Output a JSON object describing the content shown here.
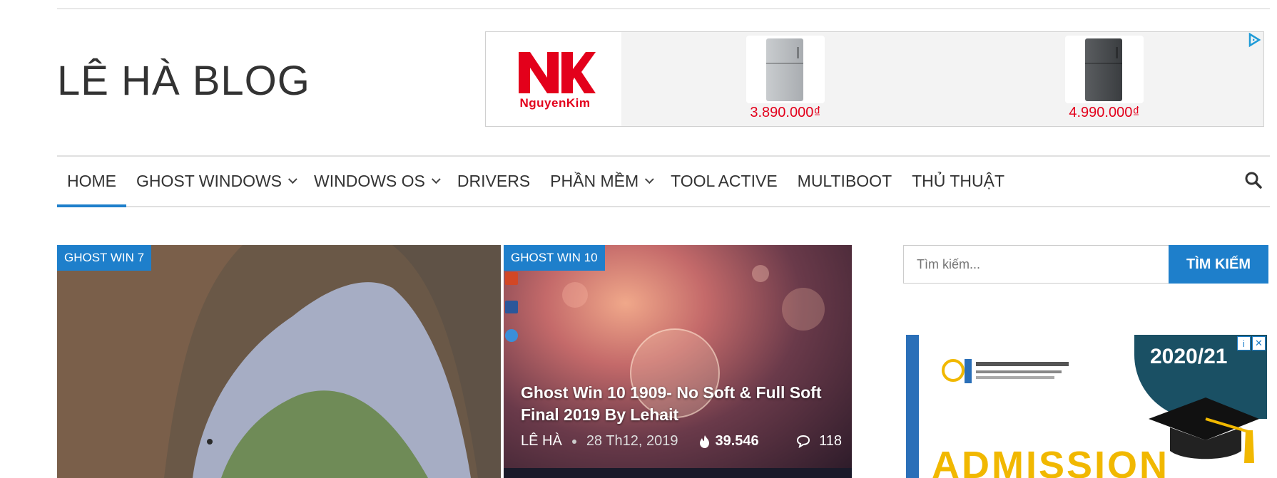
{
  "site": {
    "title": "LÊ HÀ BLOG"
  },
  "ad_banner": {
    "brand": "NK",
    "brand_sub": "NguyenKim",
    "products": [
      {
        "price": "3.890.000₫",
        "color": "#b8bcbf"
      },
      {
        "price": "4.990.000₫",
        "color": "#4a4d50"
      }
    ]
  },
  "nav": {
    "items": [
      {
        "label": "HOME",
        "active": true,
        "dropdown": false
      },
      {
        "label": "GHOST WINDOWS",
        "active": false,
        "dropdown": true
      },
      {
        "label": "WINDOWS OS",
        "active": false,
        "dropdown": true
      },
      {
        "label": "DRIVERS",
        "active": false,
        "dropdown": false
      },
      {
        "label": "PHẦN MỀM",
        "active": false,
        "dropdown": true
      },
      {
        "label": "TOOL ACTIVE",
        "active": false,
        "dropdown": false
      },
      {
        "label": "MULTIBOOT",
        "active": false,
        "dropdown": false
      },
      {
        "label": "THỦ THUẬT",
        "active": false,
        "dropdown": false
      }
    ],
    "search_icon": "search-icon"
  },
  "posts": [
    {
      "category": "GHOST WIN 7"
    },
    {
      "category": "GHOST WIN 10",
      "title": "Ghost Win 10 1909- No Soft & Full Soft Final 2019 By Lehait",
      "author": "LÊ HÀ",
      "date": "28 Th12, 2019",
      "views": "39.546",
      "comments": "118"
    }
  ],
  "sidebar": {
    "search": {
      "placeholder": "Tìm kiếm...",
      "button": "TÌM KIẾM"
    },
    "ad": {
      "year": "2020/21",
      "headline": "ADMISSION"
    }
  },
  "colors": {
    "accent": "#1e7fcb",
    "brand_red": "#e3001b",
    "admission_yellow": "#f1b800"
  }
}
